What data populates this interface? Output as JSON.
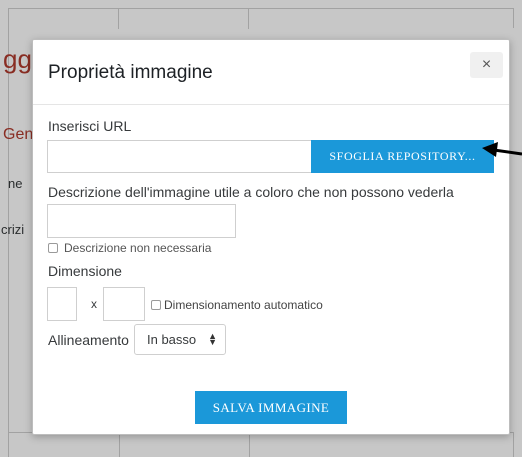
{
  "background": {
    "title_fragment": "ggi",
    "section_fragment": "Gen",
    "line1_fragment": "ne",
    "line2_fragment": "crizi"
  },
  "dialog": {
    "title": "Proprietà immagine",
    "close_label": "×",
    "url_label": "Inserisci URL",
    "url_value": "",
    "browse_label": "SFOGLIA REPOSITORY...",
    "description_label": "Descrizione dell'immagine utile a coloro che non possono vederla",
    "description_value": "",
    "no_description_label": "Descrizione non necessaria",
    "dimension_label": "Dimensione",
    "width_value": "",
    "height_value": "",
    "dimension_separator": "x",
    "auto_size_label": "Dimensionamento automatico",
    "alignment_label": "Allineamento",
    "alignment_selected": "In basso",
    "save_label": "SALVA IMMAGINE"
  },
  "icons": {
    "close": "close-icon",
    "select_arrow": "select-updown-icon",
    "annotation": "annotation-arrow-icon"
  },
  "colors": {
    "accent": "#1b98d9",
    "background_heading": "#b03a2e"
  }
}
